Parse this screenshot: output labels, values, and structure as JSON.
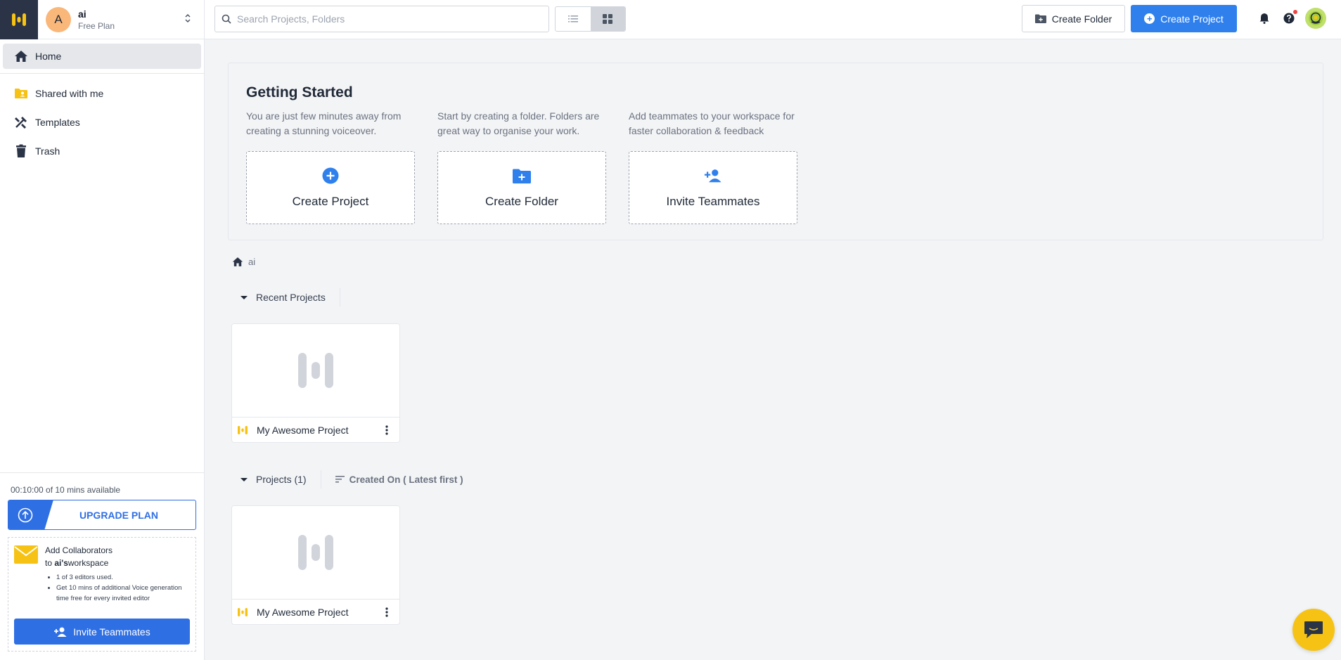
{
  "workspace": {
    "avatar_letter": "A",
    "name": "ai",
    "plan": "Free Plan"
  },
  "sidebar": {
    "items": [
      {
        "label": "Home",
        "icon": "home-icon",
        "active": true
      },
      {
        "label": "Shared with me",
        "icon": "shared-folder-icon"
      },
      {
        "label": "Templates",
        "icon": "templates-icon"
      },
      {
        "label": "Trash",
        "icon": "trash-icon"
      }
    ],
    "usage": "00:10:00 of 10 mins available",
    "upgrade_label": "UPGRADE PLAN",
    "collab": {
      "title_line1": "Add Collaborators",
      "title_prefix": "to ",
      "workspace_bold": "ai's",
      "title_suffix": "workspace",
      "bullets": [
        "1 of 3 editors used.",
        "Get 10 mins of additional Voice generation time free for every invited editor"
      ],
      "invite_label": "Invite Teammates"
    }
  },
  "topbar": {
    "search_placeholder": "Search Projects, Folders",
    "create_folder_label": "Create Folder",
    "create_project_label": "Create Project"
  },
  "getting_started": {
    "title": "Getting Started",
    "cards": [
      {
        "desc": "You are just few minutes away from creating a stunning voiceover.",
        "label": "Create Project",
        "icon": "plus-circle-icon"
      },
      {
        "desc": "Start by creating a folder. Folders are great way to organise your work.",
        "label": "Create Folder",
        "icon": "folder-add-icon"
      },
      {
        "desc": "Add teammates to your workspace for faster collaboration & feedback",
        "label": "Invite Teammates",
        "icon": "add-person-icon"
      }
    ]
  },
  "breadcrumb": {
    "label": "ai"
  },
  "recent": {
    "heading": "Recent Projects",
    "projects": [
      {
        "name": "My Awesome Project"
      }
    ]
  },
  "projects": {
    "heading": "Projects (1)",
    "sort_label": "Created On ( Latest first )",
    "items": [
      {
        "name": "My Awesome Project"
      }
    ]
  },
  "colors": {
    "accent": "#2f80ed",
    "brand_yellow": "#f6c314",
    "sidebar_logo_bg": "#2b3447"
  }
}
